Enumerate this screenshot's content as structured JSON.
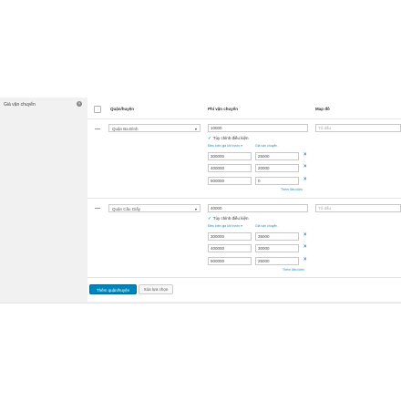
{
  "section": {
    "label": "Giá vận chuyển",
    "help": "?"
  },
  "columns": {
    "district": "Quận/huyện",
    "fee": "Phí vận chuyển",
    "map": "Map đồ"
  },
  "rows": [
    {
      "district": "Quận Ba Đình",
      "fee": "10000",
      "map_placeholder": "Tô dấu",
      "conditional_label": "Tùy chỉnh điều kiện",
      "sub_left": "Điều kiện giá khi trước ▾",
      "sub_right": "Giá vận chuyển",
      "conditions": [
        {
          "amount": "300000",
          "fee": "25000"
        },
        {
          "amount": "400000",
          "fee": "20000"
        },
        {
          "amount": "500000",
          "fee": "0"
        }
      ],
      "add_condition": "Thêm điều kiện"
    },
    {
      "district": "Quận Cầu Giấy",
      "fee": "40000",
      "map_placeholder": "Tô dấu",
      "conditional_label": "Tùy chỉnh điều kiện",
      "sub_left": "Điều kiện giá khi trước ▾",
      "sub_right": "Giá vận chuyển",
      "conditions": [
        {
          "amount": "300000",
          "fee": "35000"
        },
        {
          "amount": "400000",
          "fee": "30000"
        },
        {
          "amount": "500000",
          "fee": "25000"
        }
      ],
      "add_condition": "Thêm điều kiện"
    }
  ],
  "buttons": {
    "add": "Thêm quận/huyện",
    "delete": "Xóa lựa chọn"
  },
  "remove_symbol": "×",
  "colors": {
    "accent": "#0085ba",
    "link": "#1e8cbe",
    "panel": "#f1f1f1"
  }
}
